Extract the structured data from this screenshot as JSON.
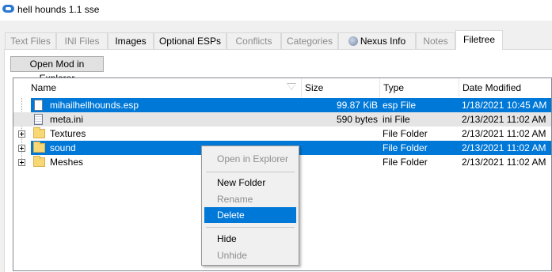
{
  "window": {
    "title": "hell hounds 1.1 sse"
  },
  "tabs": [
    {
      "label": "Text Files",
      "state": "disabled"
    },
    {
      "label": "INI Files",
      "state": "disabled"
    },
    {
      "label": "Images",
      "state": "enabled"
    },
    {
      "label": "Optional ESPs",
      "state": "enabled"
    },
    {
      "label": "Conflicts",
      "state": "disabled"
    },
    {
      "label": "Categories",
      "state": "disabled"
    },
    {
      "label": "Nexus Info",
      "state": "enabled"
    },
    {
      "label": "Notes",
      "state": "disabled"
    },
    {
      "label": "Filetree",
      "state": "active"
    }
  ],
  "toolbar": {
    "open_explorer_label": "Open Mod in Explorer"
  },
  "tree": {
    "columns": {
      "name": "Name",
      "size": "Size",
      "type": "Type",
      "date": "Date Modified"
    },
    "rows": [
      {
        "name": "mihailhellhounds.esp",
        "size": "99.87 KiB",
        "type": "esp File",
        "date": "1/18/2021 10:45 AM",
        "icon": "file-icon",
        "selected": true
      },
      {
        "name": "meta.ini",
        "size": "590 bytes",
        "type": "ini File",
        "date": "2/13/2021 11:02 AM",
        "icon": "file-icon",
        "selected": false
      },
      {
        "name": "Textures",
        "size": "",
        "type": "File Folder",
        "date": "2/13/2021 11:02 AM",
        "icon": "folder-icon",
        "selected": false
      },
      {
        "name": "sound",
        "size": "",
        "type": "File Folder",
        "date": "2/13/2021 11:02 AM",
        "icon": "folder-icon",
        "selected": true
      },
      {
        "name": "Meshes",
        "size": "",
        "type": "File Folder",
        "date": "2/13/2021 11:02 AM",
        "icon": "folder-icon",
        "selected": false
      }
    ]
  },
  "context_menu": {
    "items": [
      {
        "label": "Open in Explorer",
        "enabled": false
      },
      {
        "label": "New Folder",
        "enabled": true
      },
      {
        "label": "Rename",
        "enabled": false
      },
      {
        "label": "Delete",
        "enabled": true,
        "highlighted": true
      },
      {
        "label": "Hide",
        "enabled": true
      },
      {
        "label": "Unhide",
        "enabled": false
      }
    ]
  },
  "colors": {
    "selection": "#0078d7",
    "app_icon": "#2b78d4"
  }
}
